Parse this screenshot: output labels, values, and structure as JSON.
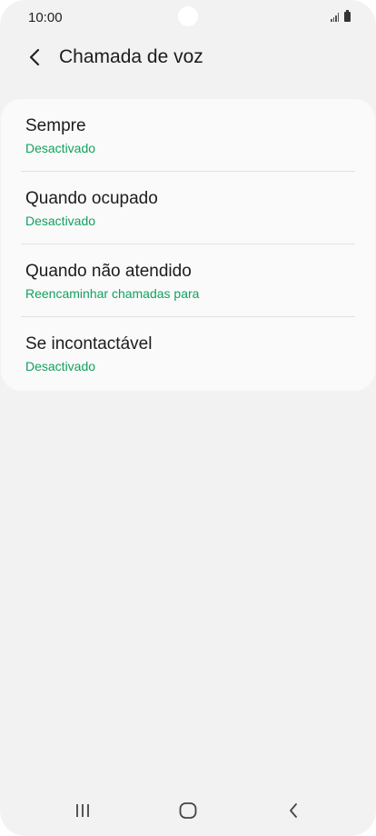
{
  "status_bar": {
    "time": "10:00"
  },
  "header": {
    "title": "Chamada de voz",
    "back_icon": "chevron-left-icon"
  },
  "forwarding_options": [
    {
      "title": "Sempre",
      "status": "Desactivado"
    },
    {
      "title": "Quando ocupado",
      "status": "Desactivado"
    },
    {
      "title": "Quando não atendido",
      "status": "Reencaminhar chamadas para"
    },
    {
      "title": "Se incontactável",
      "status": "Desactivado"
    }
  ],
  "navigation": {
    "recents_icon": "recent-apps-icon",
    "home_icon": "home-icon",
    "back_icon": "back-icon"
  },
  "colors": {
    "accent": "#13a05e",
    "background": "#f2f2f2",
    "card": "#fafafa"
  }
}
